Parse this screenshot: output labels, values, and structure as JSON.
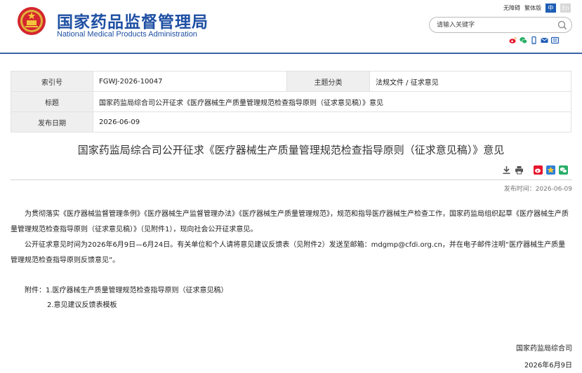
{
  "header": {
    "title_cn": "国家药品监督管理局",
    "title_en": "National Medical Products Administration",
    "links": {
      "accessibility": "无障碍",
      "traditional": "繁体版",
      "lang_cn": "中",
      "lang_en": "En"
    },
    "search_placeholder": "请输入关键字",
    "social_icons": [
      "weibo-icon",
      "wechat-icon",
      "mobile-icon",
      "email-icon",
      "mail-icon"
    ]
  },
  "meta": {
    "index_label": "索引号",
    "index_value": "FGWJ-2026-10047",
    "category_label": "主题分类",
    "category_value": "法规文件 / 征求意见",
    "title_label": "标题",
    "title_value": "国家药监局综合司公开征求《医疗器械生产质量管理规范检查指导原则（征求意见稿）》意见",
    "date_label": "发布日期",
    "date_value": "2026-06-09"
  },
  "article": {
    "title": "国家药监局综合司公开征求《医疗器械生产质量管理规范检查指导原则（征求意见稿）》意见",
    "publish_time": "发布时间：2026-06-09",
    "paragraph1": "为贯彻落实《医疗器械监督管理条例》《医疗器械生产监督管理办法》《医疗器械生产质量管理规范》，规范和指导医疗器械生产检查工作，国家药监局组织起草《医疗器械生产质量管理规范检查指导原则（征求意见稿）》（见附件1），现向社会公开征求意见。",
    "paragraph2": "公开征求意见时间为2026年6月9日—6月24日。有关单位和个人请将意见建议反馈表（见附件2）发送至邮箱：mdgmp@cfdi.org.cn，并在电子邮件注明“医疗器械生产质量管理规范检查指导原则反馈意见”。",
    "attachment1": "附件：1.医疗器械生产质量管理规范检查指导原则（征求意见稿）",
    "attachment2": "2.意见建议反馈表模板",
    "signature": "国家药监局综合司",
    "sign_date": "2026年6月9日"
  },
  "colors": {
    "brand_blue": "#1e4fa3",
    "header_rule": "#3a63a8",
    "table_key_bg": "#efefef"
  }
}
